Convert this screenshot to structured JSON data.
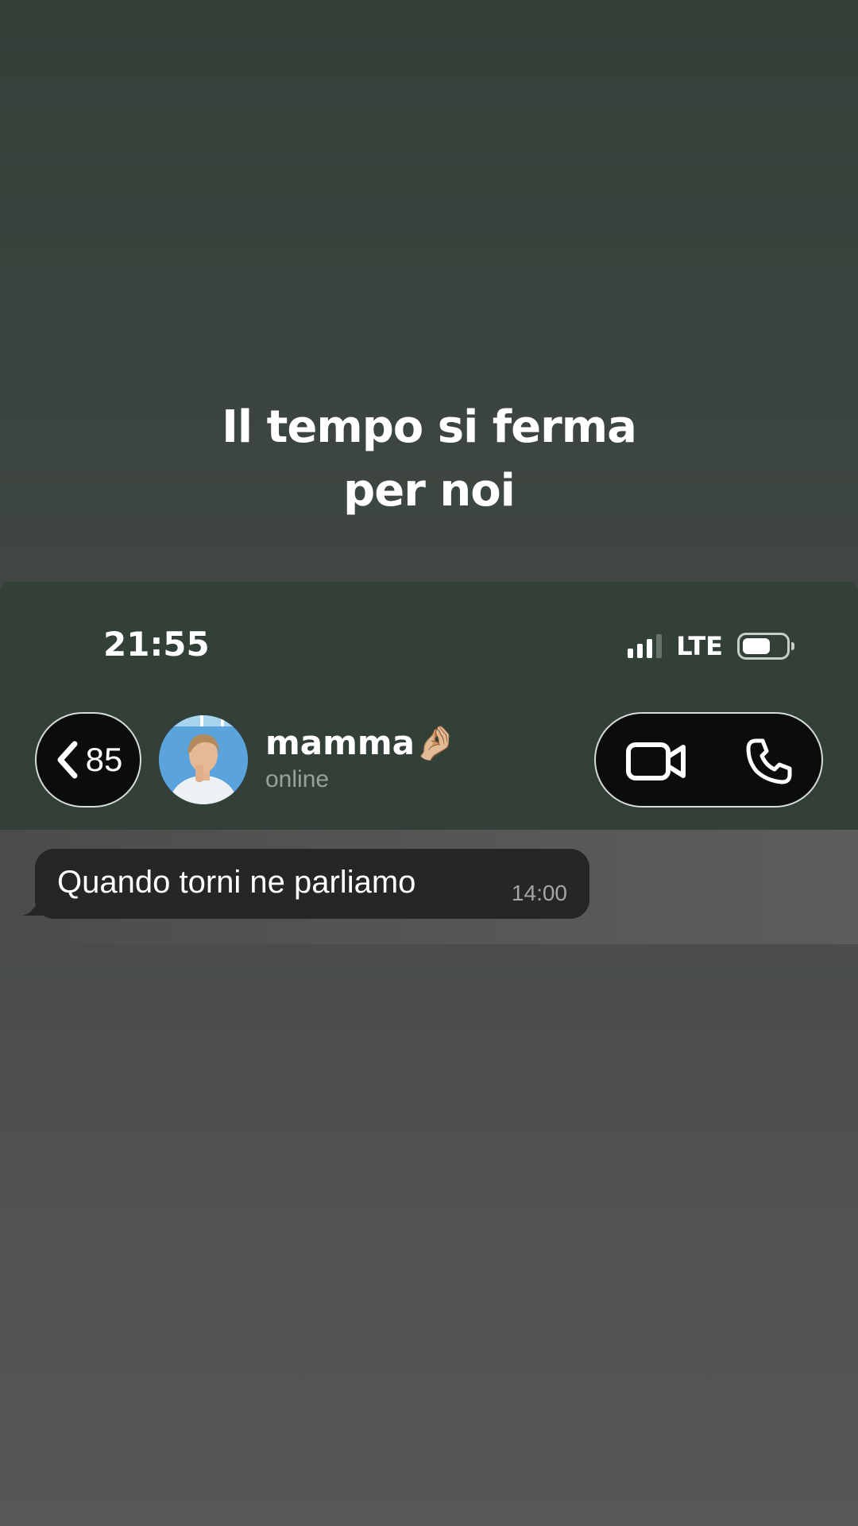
{
  "caption": {
    "line1": "Il tempo si ferma",
    "line2": "per noi"
  },
  "status_bar": {
    "time": "21:55",
    "network": "LTE",
    "signal_bars": 4,
    "signal_active_bars": 3,
    "battery_level": 0.5
  },
  "header": {
    "back_count": "85",
    "contact_name": "mamma",
    "contact_emoji": "🤌🏼",
    "contact_status": "online",
    "video_icon": "video-camera-icon",
    "phone_icon": "phone-icon"
  },
  "messages": [
    {
      "text": "Quando torni ne parliamo",
      "time": "14:00",
      "direction": "incoming"
    }
  ],
  "colors": {
    "header_bg": "#324038",
    "bubble_bg": "#252625",
    "pill_bg": "#0a0d0b"
  }
}
